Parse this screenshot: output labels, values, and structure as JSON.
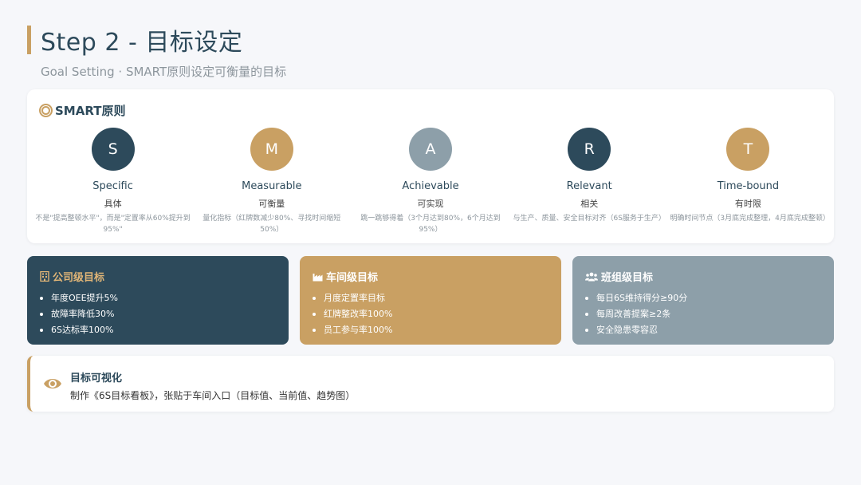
{
  "header": {
    "title": "Step 2 - 目标设定",
    "subtitle": "Goal Setting · SMART原则设定可衡量的目标"
  },
  "smart": {
    "title": "SMART原则",
    "icon": "target-icon",
    "items": [
      {
        "letter": "S",
        "color": "#2d4a5b",
        "name": "Specific",
        "cn": "具体",
        "desc": "不是\"提高整顿水平\"，而是\"定置率从60%提升到95%\""
      },
      {
        "letter": "M",
        "color": "#c9a063",
        "name": "Measurable",
        "cn": "可衡量",
        "desc": "量化指标（红牌数减少80%、寻找时间缩短50%）"
      },
      {
        "letter": "A",
        "color": "#8d9fa9",
        "name": "Achievable",
        "cn": "可实现",
        "desc": "跳一跳够得着（3个月达到80%，6个月达到95%）"
      },
      {
        "letter": "R",
        "color": "#2d4a5b",
        "name": "Relevant",
        "cn": "相关",
        "desc": "与生产、质量、安全目标对齐（6S服务于生产）"
      },
      {
        "letter": "T",
        "color": "#c9a063",
        "name": "Time-bound",
        "cn": "有时限",
        "desc": "明确时间节点（3月底完成整理，4月底完成整顿）"
      }
    ]
  },
  "levels": [
    {
      "title": "公司级目标",
      "icon": "building-icon",
      "color": "#2d4a5b",
      "title_color": "#e0b577",
      "items": [
        "年度OEE提升5%",
        "故障率降低30%",
        "6S达标率100%"
      ]
    },
    {
      "title": "车间级目标",
      "icon": "factory-icon",
      "color": "#c9a063",
      "title_color": "#ffffff",
      "items": [
        "月度定置率目标",
        "红牌整改率100%",
        "员工参与率100%"
      ]
    },
    {
      "title": "班组级目标",
      "icon": "team-icon",
      "color": "#8d9fa9",
      "title_color": "#ffffff",
      "items": [
        "每日6S维持得分≥90分",
        "每周改善提案≥2条",
        "安全隐患零容忍"
      ]
    }
  ],
  "visualization": {
    "icon": "eye-icon",
    "title": "目标可视化",
    "text": "制作《6S目标看板》，张贴于车间入口（目标值、当前值、趋势图）"
  }
}
